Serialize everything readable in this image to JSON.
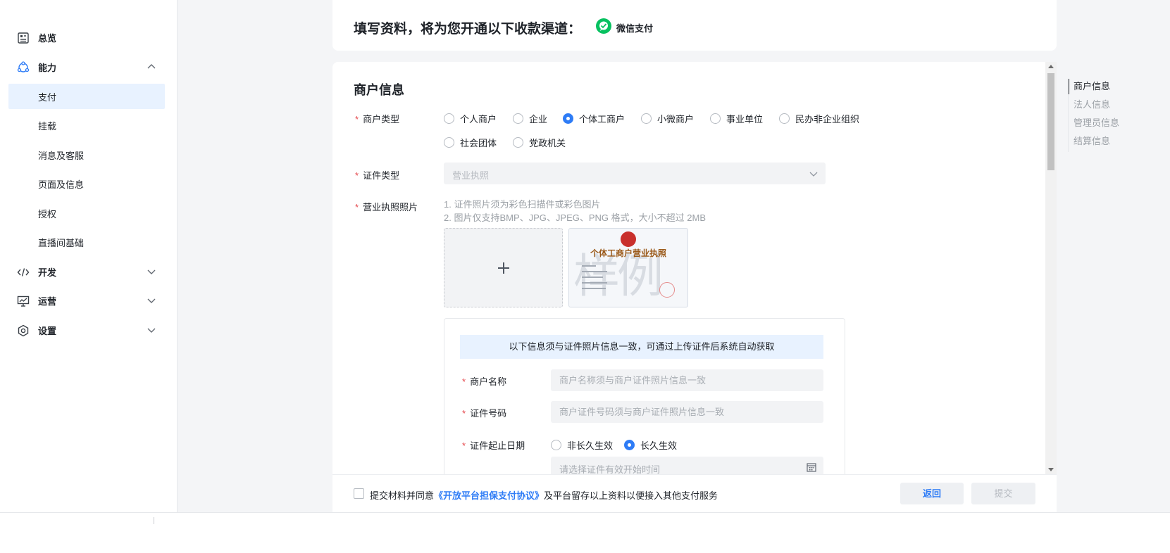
{
  "sidebar": {
    "items": [
      {
        "label": "总览",
        "icon": "overview-icon"
      },
      {
        "label": "能力",
        "icon": "capability-icon"
      },
      {
        "label": "支付"
      },
      {
        "label": "挂载"
      },
      {
        "label": "消息及客服"
      },
      {
        "label": "页面及信息"
      },
      {
        "label": "授权"
      },
      {
        "label": "直播间基础"
      },
      {
        "label": "开发",
        "icon": "code-icon"
      },
      {
        "label": "运营",
        "icon": "chart-icon"
      },
      {
        "label": "设置",
        "icon": "gear-icon"
      }
    ],
    "active": "支付"
  },
  "header": {
    "title": "填写资料，将为您开通以下收款渠道：",
    "channel_label": "微信支付",
    "channel_color": "#07c160"
  },
  "form": {
    "section_title": "商户信息",
    "merchant_type": {
      "label": "商户类型",
      "options": [
        "个人商户",
        "企业",
        "个体工商户",
        "小微商户",
        "事业单位",
        "民办非企业组织",
        "社会团体",
        "党政机关"
      ],
      "selected": "个体工商户"
    },
    "cert_type": {
      "label": "证件类型",
      "value": "营业执照"
    },
    "license_photo": {
      "label": "营业执照照片",
      "hint1": "1. 证件照片须为彩色扫描件或彩色图片",
      "hint2": "2. 图片仅支持BMP、JPG、JPEG、PNG 格式，大小不超过 2MB",
      "sample_title": "个体工商户营业执照",
      "sample_watermark": "样例"
    },
    "sub": {
      "banner": "以下信息须与证件照片信息一致，可通过上传证件后系统自动获取",
      "merchant_name": {
        "label": "商户名称",
        "placeholder": "商户名称须与商户证件照片信息一致"
      },
      "cert_number": {
        "label": "证件号码",
        "placeholder": "商户证件号码须与商户证件照片信息一致"
      },
      "validity": {
        "label": "证件起止日期",
        "options": [
          "非长久生效",
          "长久生效"
        ],
        "selected": "长久生效",
        "start_placeholder": "请选择证件有效开始时间"
      }
    }
  },
  "anchor_nav": {
    "items": [
      "商户信息",
      "法人信息",
      "管理员信息",
      "结算信息"
    ],
    "active": "商户信息"
  },
  "footer": {
    "agree_prefix": "提交材料并同意",
    "agree_link": "《开放平台担保支付协议》",
    "agree_suffix": "及平台留存以上资料以便接入其他支付服务",
    "back_label": "返回",
    "submit_label": "提交"
  },
  "colors": {
    "accent": "#2e7cf6",
    "required": "#e5484d",
    "active_bg": "#e8f2ff"
  }
}
